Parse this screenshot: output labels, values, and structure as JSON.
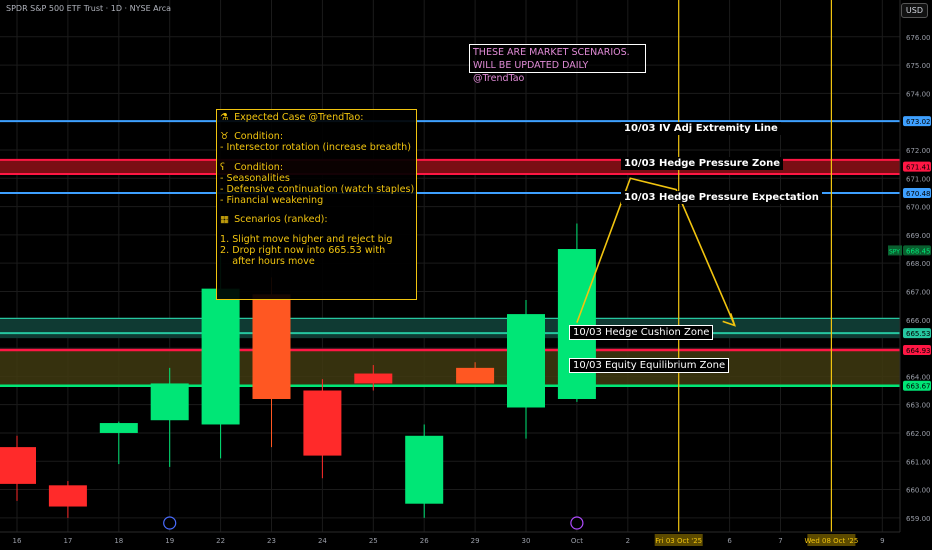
{
  "header": {
    "title": "SPDR S&P 500 ETF Trust · 1D · NYSE Arca"
  },
  "currency_button": "USD",
  "banner": {
    "line1": "THESE ARE MARKET SCENARIOS.",
    "line2": "WILL BE UPDATED DAILY @TrendTao"
  },
  "scenario_box": {
    "title": "Expected Case @TrendTao:",
    "bull_heading": "Condition:",
    "bull_item": "- Intersector rotation (increase breadth)",
    "bear_heading": "Condition:",
    "bear_items": [
      "- Seasonalities",
      "- Defensive continuation (watch staples)",
      "- Financial weakening"
    ],
    "scenarios_heading": "Scenarios (ranked):",
    "scenarios": [
      "1. Slight move higher and reject big",
      "2. Drop right now into 665.53 with",
      "    after hours move"
    ]
  },
  "level_labels": {
    "iv_line": "10/03 IV Adj Extremity Line",
    "hedge_pressure": "10/03 Hedge Pressure Zone",
    "hedge_expectation": "10/03 Hedge Pressure Expectation",
    "hedge_cushion": "10/03 Hedge Cushion Zone",
    "equity_equilibrium": "10/03 Equity Equilibrium Zone"
  },
  "colors": {
    "bull": "#00e676",
    "bear": "#ff2a2a",
    "bear_orange": "#ff5722",
    "blue_line": "#3ea0ff",
    "red_zone": "#ff1744",
    "green_line": "#00e676",
    "yellow": "#f1c40f",
    "teal": "#26c6a0",
    "zone_fill": "#3f3a10"
  },
  "chart_data": {
    "type": "candlestick",
    "y_axis": {
      "min": 658.5,
      "max": 677.3,
      "ticks": [
        659,
        660,
        661,
        662,
        663,
        664,
        665,
        666,
        667,
        668,
        669,
        670,
        671,
        672,
        673,
        674,
        675,
        676
      ]
    },
    "x_ticks": [
      "16",
      "17",
      "18",
      "19",
      "22",
      "23",
      "24",
      "25",
      "26",
      "29",
      "30",
      "Oct",
      "2",
      "Fri 03 Oct '25",
      "6",
      "7",
      "Wed 08 Oct '25",
      "9"
    ],
    "x_tick_index": [
      0,
      1,
      2,
      3,
      4,
      5,
      6,
      7,
      8,
      9,
      10,
      11,
      12,
      13,
      14,
      15,
      16,
      17
    ],
    "candles": [
      {
        "x": 0,
        "o": 661.5,
        "h": 661.9,
        "l": 659.6,
        "c": 660.2
      },
      {
        "x": 1,
        "o": 660.15,
        "h": 660.3,
        "l": 659.0,
        "c": 659.4
      },
      {
        "x": 2,
        "o": 662.0,
        "h": 662.4,
        "l": 660.9,
        "c": 662.35
      },
      {
        "x": 3,
        "o": 662.45,
        "h": 664.3,
        "l": 660.8,
        "c": 663.75
      },
      {
        "x": 4,
        "o": 662.3,
        "h": 668.3,
        "l": 661.1,
        "c": 667.1
      },
      {
        "x": 5,
        "o": 666.9,
        "h": 667.5,
        "l": 661.5,
        "c": 663.2
      },
      {
        "x": 6,
        "o": 663.5,
        "h": 663.9,
        "l": 660.4,
        "c": 661.2
      },
      {
        "x": 7,
        "o": 664.1,
        "h": 664.4,
        "l": 663.5,
        "c": 663.75
      },
      {
        "x": 8,
        "o": 659.5,
        "h": 662.3,
        "l": 659.0,
        "c": 661.9
      },
      {
        "x": 9,
        "o": 664.3,
        "h": 664.5,
        "l": 663.8,
        "c": 663.75
      },
      {
        "x": 10,
        "o": 662.9,
        "h": 666.7,
        "l": 661.8,
        "c": 666.2
      },
      {
        "x": 11,
        "o": 663.2,
        "h": 669.4,
        "l": 663.1,
        "c": 668.5
      }
    ],
    "levels": [
      {
        "name": "IV Adj Extremity Line",
        "price": 673.02,
        "label": "673.02"
      },
      {
        "name": "Hedge Pressure Zone",
        "price": 671.41,
        "label": "671.41"
      },
      {
        "name": "Hedge Pressure Expectation",
        "price": 670.48,
        "label": "670.48"
      },
      {
        "name": "Hedge Cushion Zone",
        "price": 665.53,
        "label": "665.53"
      },
      {
        "name": "Red line",
        "price": 664.93,
        "label": "664.93"
      },
      {
        "name": "Equity Equilibrium Zone",
        "price": 663.67,
        "label": "663.67"
      }
    ],
    "last_price": {
      "symbol": "SPY",
      "price": 668.45,
      "label": "668.45"
    },
    "projection_path": [
      {
        "x": 11.0,
        "y": 665.9
      },
      {
        "x": 12.05,
        "y": 671.0
      },
      {
        "x": 12.95,
        "y": 670.6
      },
      {
        "x": 14.1,
        "y": 665.8
      }
    ],
    "vertical_markers": [
      "Fri 03 Oct '25",
      "Wed 08 Oct '25"
    ]
  }
}
